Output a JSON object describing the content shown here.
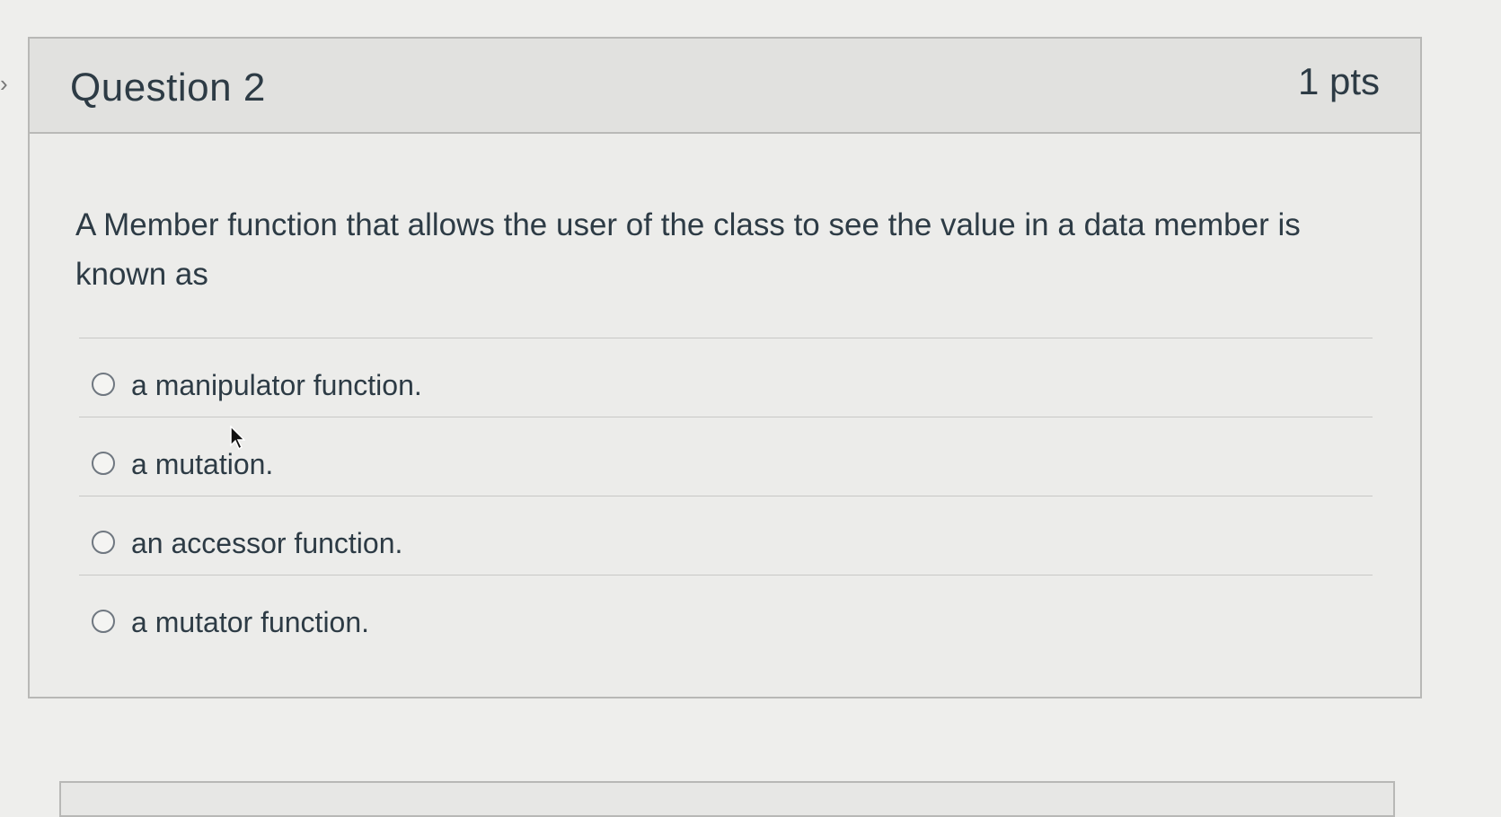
{
  "question": {
    "title": "Question 2",
    "points": "1 pts",
    "text": "A Member function that allows the user of the class to see the value in a data member is known as"
  },
  "answers": [
    {
      "label": "a manipulator function."
    },
    {
      "label": "a mutation."
    },
    {
      "label": "an accessor function."
    },
    {
      "label": "a mutator function."
    }
  ],
  "icons": {
    "navigation": "chevron-right-icon",
    "cursor": "mouse-pointer-icon"
  }
}
